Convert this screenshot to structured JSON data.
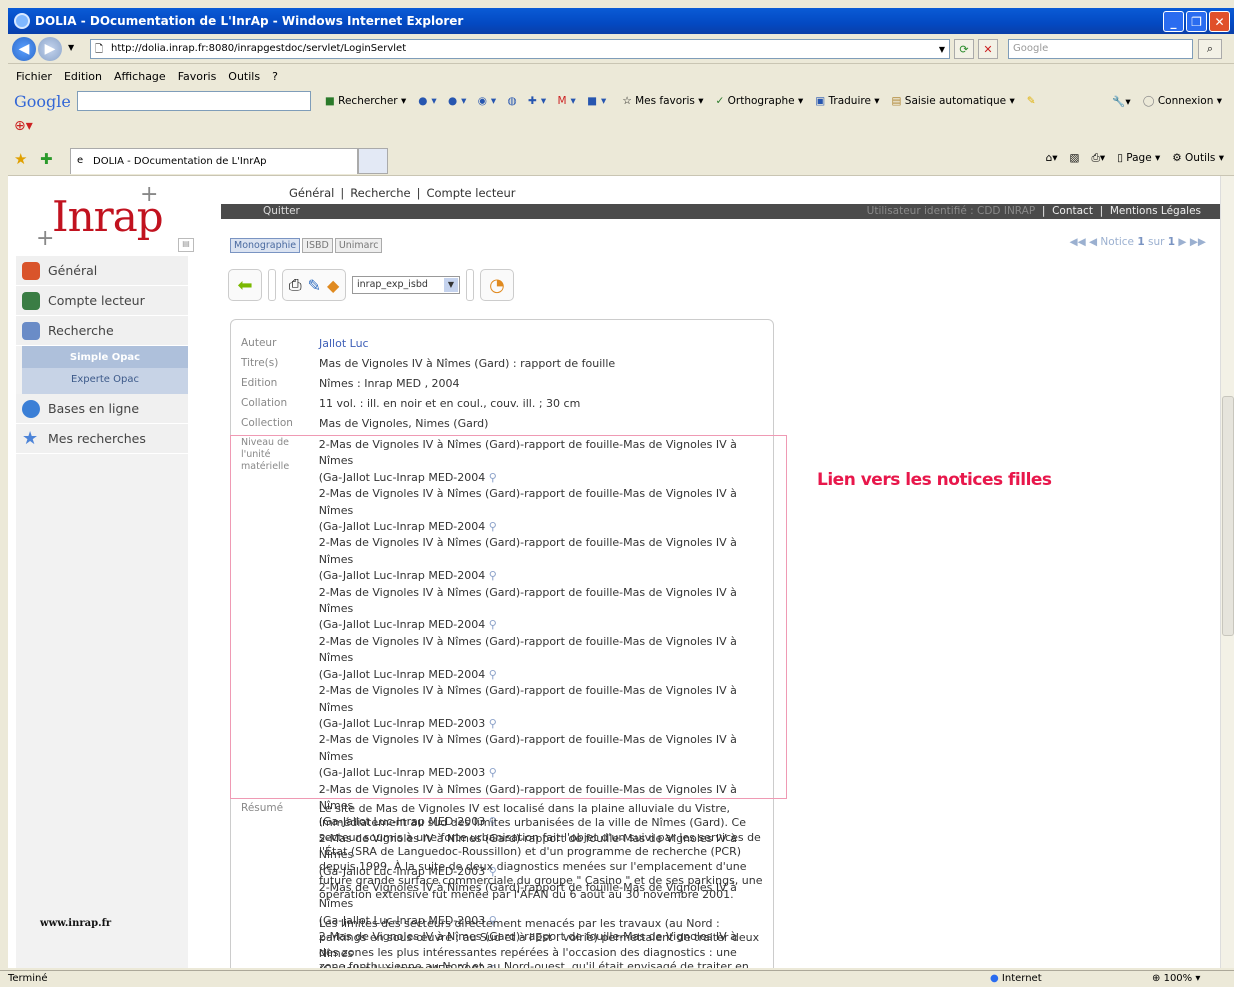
{
  "window": {
    "title": "DOLIA - DOcumentation de L'InrAp - Windows Internet Explorer"
  },
  "browser": {
    "url": "http://dolia.inrap.fr:8080/inrapgestdoc/servlet/LoginServlet",
    "search_placeholder": "Google",
    "menu": [
      "Fichier",
      "Edition",
      "Affichage",
      "Favoris",
      "Outils",
      "?"
    ],
    "google_toolbar": {
      "logo": "Google",
      "items": [
        "Rechercher",
        "Mes favoris",
        "Orthographe",
        "Traduire",
        "Saisie automatique",
        "Connexion"
      ]
    },
    "tab_title": "DOLIA - DOcumentation de L'InrAp",
    "commands": [
      "Page",
      "Outils"
    ]
  },
  "site": {
    "logo": "Inrap",
    "topnav": [
      "Général",
      "Recherche",
      "Compte lecteur"
    ],
    "quitter": "Quitter",
    "user_info": "Utilisateur identifié : CDD INRAP",
    "links": [
      "Contact",
      "Mentions Légales"
    ],
    "sidebar": [
      {
        "label": "Général",
        "color": "#d9542b"
      },
      {
        "label": "Compte lecteur",
        "color": "#3a7d44"
      },
      {
        "label": "Recherche",
        "color": "#6a8cc7"
      }
    ],
    "sub": [
      "Simple Opac",
      "Experte Opac"
    ],
    "sidebar2": [
      {
        "label": "Bases en ligne",
        "color": "#3b7fd6"
      },
      {
        "label": "Mes recherches",
        "color": "#4d84d8"
      }
    ],
    "footer_link": "www.inrap.fr",
    "format_tabs": [
      "Monographie",
      "ISBD",
      "Unimarc"
    ],
    "notice_nav": {
      "label": "Notice",
      "current": "1",
      "sep": "sur",
      "total": "1"
    },
    "export_select": "inrap_exp_isbd"
  },
  "record": {
    "fields": [
      {
        "label": "Auteur",
        "value": "Jallot Luc"
      },
      {
        "label": "Titre(s)",
        "value": "Mas de Vignoles IV à Nîmes (Gard) : rapport de fouille"
      },
      {
        "label": "Edition",
        "value": "Nîmes : Inrap MED , 2004"
      },
      {
        "label": "Collation",
        "value": "11 vol. : ill. en noir et en coul., couv. ill. ; 30 cm"
      },
      {
        "label": "Collection",
        "value": "Mas de Vignoles, Nimes (Gard)"
      }
    ],
    "level_label": "Niveau de l'unité matérielle",
    "level_items": [
      {
        "l1": "2-Mas de Vignoles IV à Nîmes (Gard)-rapport de fouille-Mas de Vignoles IV à Nîmes",
        "l2": "(Ga-Jallot Luc-Inrap MED-2004"
      },
      {
        "l1": "2-Mas de Vignoles IV à Nîmes (Gard)-rapport de fouille-Mas de Vignoles IV à Nîmes",
        "l2": "(Ga-Jallot Luc-Inrap MED-2004"
      },
      {
        "l1": "2-Mas de Vignoles IV à Nîmes (Gard)-rapport de fouille-Mas de Vignoles IV à Nîmes",
        "l2": "(Ga-Jallot Luc-Inrap MED-2004"
      },
      {
        "l1": "2-Mas de Vignoles IV à Nîmes (Gard)-rapport de fouille-Mas de Vignoles IV à Nîmes",
        "l2": "(Ga-Jallot Luc-Inrap MED-2004"
      },
      {
        "l1": "2-Mas de Vignoles IV à Nîmes (Gard)-rapport de fouille-Mas de Vignoles IV à Nîmes",
        "l2": "(Ga-Jallot Luc-Inrap MED-2004"
      },
      {
        "l1": "2-Mas de Vignoles IV à Nîmes (Gard)-rapport de fouille-Mas de Vignoles IV à Nîmes",
        "l2": "(Ga-Jallot Luc-Inrap MED-2003"
      },
      {
        "l1": "2-Mas de Vignoles IV à Nîmes (Gard)-rapport de fouille-Mas de Vignoles IV à Nîmes",
        "l2": "(Ga-Jallot Luc-Inrap MED-2003"
      },
      {
        "l1": "2-Mas de Vignoles IV à Nîmes (Gard)-rapport de fouille-Mas de Vignoles IV à Nîmes",
        "l2": "(Ga-Jallot Luc-Inrap MED-2003"
      },
      {
        "l1": "2-Mas de Vignoles IV à Nîmes (Gard)-rapport de fouille-Mas de Vignoles IV à Nîmes",
        "l2": "(Ga-Jallot Luc-Inrap MED-2003"
      },
      {
        "l1": "2-Mas de Vignoles IV à Nîmes (Gard)-rapport de fouille-Mas de Vignoles IV à Nîmes",
        "l2": "(Ga-Jallot Luc-Inrap MED-2003"
      },
      {
        "l1": "2-Mas de Vignoles IV à Nîmes (Gard)-rapport de fouille-Mas de Vignoles IV à Nîmes",
        "l2": "(Ga-Jallot Luc-Inrap MED-2003"
      }
    ],
    "resume_label": "Résumé",
    "resume_p1": "Le site de Mas de Vignoles IV est localisé dans la plaine alluviale du Vistre, immédiatement au sud des limites urbanisées de la ville de Nîmes (Gard). Ce secteur soumis à une forte urbanisation fait l'objet d'un suivi par les services de l'État (SRA de Languedoc-Roussillon) et d'un programme de recherche (PCR) depuis 1999. À la suite de deux diagnostics menées sur l'emplacement d'une future grande surface commerciale du groupe \" Casino \" et de ses parkings, une opération extensive fut menée par l'AFAN du 6 août au 30 novembre 2001.",
    "resume_p2": "Les limites des secteurs directement menacés par les travaux (au Nord : parkings en sous-œuvre ; au Sud et à l'Est : voirie) permettaient de traiter deux des zones les plus intéressantes repérées à l'occasion des diagnostics : une zone fontbuxienne au Nord et au Nord-ouest, qu'il était envisagé de traiter en continu, comprenant"
  },
  "annotation": "Lien vers les notices filles",
  "status": {
    "left": "Terminé",
    "zone": "Internet",
    "zoom": "100%"
  }
}
